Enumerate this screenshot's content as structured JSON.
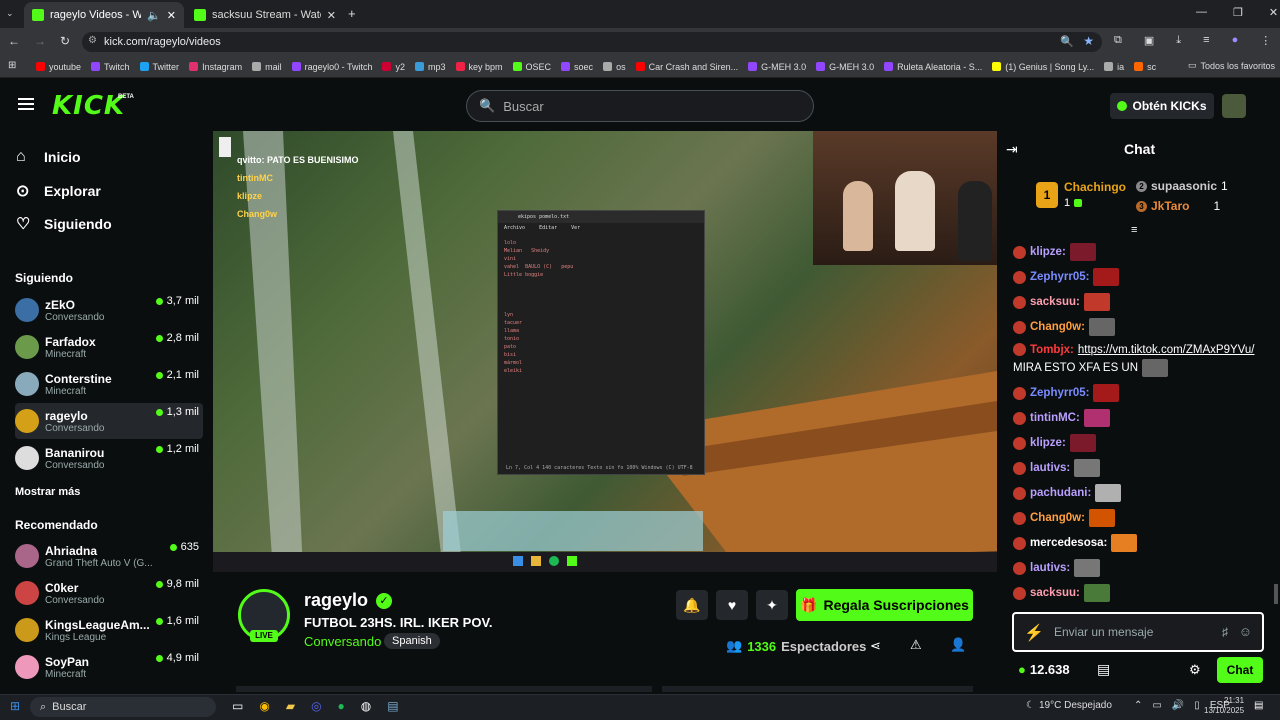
{
  "browser": {
    "tabs": [
      {
        "title": "rageylo Videos - Watch On"
      },
      {
        "title": "sacksuu Stream - Watch Live on"
      }
    ],
    "url": "kick.com/rageylo/videos",
    "bookmarks": [
      {
        "label": "youtube",
        "color": "#ff0000"
      },
      {
        "label": "Twitch",
        "color": "#9146ff"
      },
      {
        "label": "Twitter",
        "color": "#1da1f2"
      },
      {
        "label": "Instagram",
        "color": "#e1306c"
      },
      {
        "label": "mail",
        "color": "#aaaaaa"
      },
      {
        "label": "rageylo0 - Twitch",
        "color": "#9146ff"
      },
      {
        "label": "y2",
        "color": "#c03"
      },
      {
        "label": "mp3",
        "color": "#3a9bd9"
      },
      {
        "label": "key bpm",
        "color": "#e24"
      },
      {
        "label": "OSEC",
        "color": "#53fc18"
      },
      {
        "label": "soec",
        "color": "#9146ff"
      },
      {
        "label": "os",
        "color": "#aaa"
      },
      {
        "label": "Car Crash and Siren...",
        "color": "#ff0000"
      },
      {
        "label": "G-MEH 3.0",
        "color": "#9146ff"
      },
      {
        "label": "G-MEH 3.0",
        "color": "#9146ff"
      },
      {
        "label": "Ruleta Aleatoria - S...",
        "color": "#9146ff"
      },
      {
        "label": "(1) Genius | Song Ly...",
        "color": "#ff0"
      },
      {
        "label": "ia",
        "color": "#aaa"
      },
      {
        "label": "sc",
        "color": "#f60"
      }
    ],
    "all_bookmarks": "Todos los favoritos"
  },
  "header": {
    "logo": "KICK",
    "logo_beta": "BETA",
    "search_placeholder": "Buscar",
    "get_kicks": "Obtén KICKs"
  },
  "nav": [
    {
      "label": "Inicio",
      "icon": "home-icon"
    },
    {
      "label": "Explorar",
      "icon": "compass-icon"
    },
    {
      "label": "Siguiendo",
      "icon": "heart-icon"
    }
  ],
  "following_title": "Siguiendo",
  "following": [
    {
      "name": "zEkO",
      "sub": "Conversando",
      "viewers": "3,7 mil",
      "color": "#3a6ea5"
    },
    {
      "name": "Farfadox",
      "sub": "Minecraft",
      "viewers": "2,8 mil",
      "color": "#6a9a4a"
    },
    {
      "name": "Conterstine",
      "sub": "Minecraft",
      "viewers": "2,1 mil",
      "color": "#8ab"
    },
    {
      "name": "rageylo",
      "sub": "Conversando",
      "viewers": "1,3 mil",
      "color": "#d4a017"
    },
    {
      "name": "Bananirou",
      "sub": "Conversando",
      "viewers": "1,2 mil",
      "color": "#ddd"
    }
  ],
  "show_more": "Mostrar más",
  "recommended_title": "Recomendado",
  "recommended": [
    {
      "name": "Ahriadna",
      "sub": "Grand Theft Auto V (G...",
      "viewers": "635",
      "color": "#a68"
    },
    {
      "name": "C0ker",
      "sub": "Conversando",
      "viewers": "9,8 mil",
      "color": "#c44"
    },
    {
      "name": "KingsLeagueAm...",
      "sub": "Kings League",
      "viewers": "1,6 mil",
      "color": "#cc9a1a"
    },
    {
      "name": "SoyPan",
      "sub": "Minecraft",
      "viewers": "4,9 mil",
      "color": "#e9b"
    }
  ],
  "stream": {
    "overlay_chat": [
      "qvitto: PATO ES BUENISIMO",
      "tintinMC",
      "klipze",
      "Chang0w"
    ],
    "notepad_title": "ekipos pomelo.txt",
    "notepad_menu": [
      "Archivo",
      "Editar",
      "Ver"
    ],
    "notepad_lines": [
      "lolo",
      "Melian   Sheidy",
      "vini",
      "vahel  BAULO (C)   pepu",
      "Little boggie",
      "lyn",
      "tacuer",
      "llama",
      "tonio",
      "pato",
      "bisi",
      "mármol",
      "eleiki"
    ],
    "notepad_status": "Ln 7, Col 4    140 caracteres    Texto sin fo    100%    Windows (C)    UTF-8"
  },
  "channel": {
    "name": "rageylo",
    "live_badge": "LIVE",
    "title": "FUTBOL 23HS. IRL. IKER POV.",
    "category": "Conversando",
    "language": "Spanish",
    "subscribe_label": "Regala Suscripciones",
    "viewers_count": "1336",
    "viewers_label": "Espectadores"
  },
  "chat": {
    "title": "Chat",
    "leaderboard": [
      {
        "rank": "1",
        "name": "Chachingo",
        "count": "1"
      },
      {
        "rank": "2",
        "name": "supaasonic",
        "count": "1"
      },
      {
        "rank": "3",
        "name": "JkTaro",
        "count": "1"
      }
    ],
    "messages": [
      {
        "user": "klipze:",
        "color": "#b9a0ff",
        "text": ""
      },
      {
        "user": "Zephyrr05:",
        "color": "#7a8cff",
        "text": ""
      },
      {
        "user": "sacksuu:",
        "color": "#ff9fb0",
        "text": ""
      },
      {
        "user": "Chang0w:",
        "color": "#ff9f40",
        "text": ""
      },
      {
        "user": "Tombjx:",
        "color": "#ff3b3b",
        "text": "https://vm.tiktok.com/ZMAxP9YVu/"
      },
      {
        "user": "",
        "color": "#fff",
        "text": "MIRA ESTO XFA ES UN"
      },
      {
        "user": "Zephyrr05:",
        "color": "#7a8cff",
        "text": ""
      },
      {
        "user": "tintinMC:",
        "color": "#b9a0ff",
        "text": ""
      },
      {
        "user": "klipze:",
        "color": "#b9a0ff",
        "text": ""
      },
      {
        "user": "lautivs:",
        "color": "#b9a0ff",
        "text": ""
      },
      {
        "user": "pachudani:",
        "color": "#b9a0ff",
        "text": ""
      },
      {
        "user": "Chang0w:",
        "color": "#ff9f40",
        "text": ""
      },
      {
        "user": "mercedesosa:",
        "color": "#fff",
        "text": ""
      },
      {
        "user": "lautivs:",
        "color": "#b9a0ff",
        "text": ""
      },
      {
        "user": "sacksuu:",
        "color": "#ff9fb0",
        "text": ""
      }
    ],
    "input_placeholder": "Enviar un mensaje",
    "kicks_balance": "12.638",
    "send_label": "Chat"
  },
  "taskbar": {
    "search": "Buscar",
    "weather": "19°C Despejado",
    "lang": "ESP",
    "time": "21:31",
    "date": "13/10/2025"
  }
}
